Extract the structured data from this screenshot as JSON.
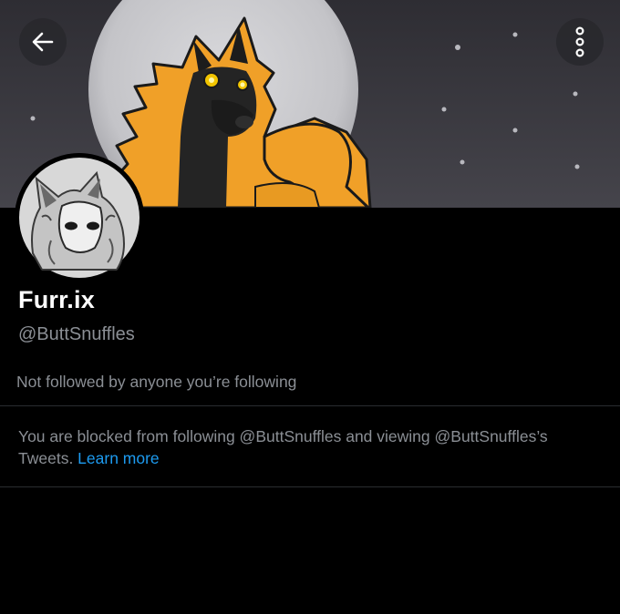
{
  "header": {
    "back_icon": "arrow-left-icon",
    "more_icon": "more-vertical-icon"
  },
  "profile": {
    "display_name": "Furr.ix",
    "handle": "@ButtSnuffles",
    "followed_by": "Not followed by anyone you’re following"
  },
  "notice": {
    "text": "You are blocked from following @ButtSnuffles and viewing @ButtSnuffles’s Tweets. ",
    "link": "Learn more"
  },
  "colors": {
    "background": "#000000",
    "link": "#1d9bf0",
    "secondary_text": "#8b8f95",
    "fur_orange": "#f0a028"
  }
}
